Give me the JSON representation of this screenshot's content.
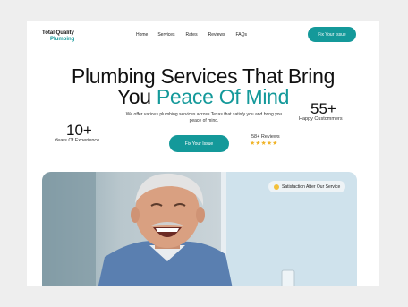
{
  "brand": {
    "line1": "Total Quality",
    "line2": "Plumbing"
  },
  "nav": [
    "Home",
    "Services",
    "Rates",
    "Reviews",
    "FAQs"
  ],
  "header_cta": "Fix Your Issue",
  "hero": {
    "title_line1": "Plumbing Services That Bring",
    "title_line2_prefix": "You ",
    "title_line2_accent": "Peace Of Mind",
    "description": "We offer various plumbing services across Texas that satisfy you and bring you peace of mind.",
    "cta": "Fix Your Issue",
    "stat_left_value": "10+",
    "stat_left_label": "Years Of Experience",
    "stat_right_value": "55+",
    "stat_right_label": "Happy Custommers",
    "reviews_label": "58+ Reviews",
    "stars": "★★★★★"
  },
  "photo_badge": "Satisfaction After Our Service",
  "colors": {
    "accent": "#14999a",
    "star": "#f0b429"
  }
}
